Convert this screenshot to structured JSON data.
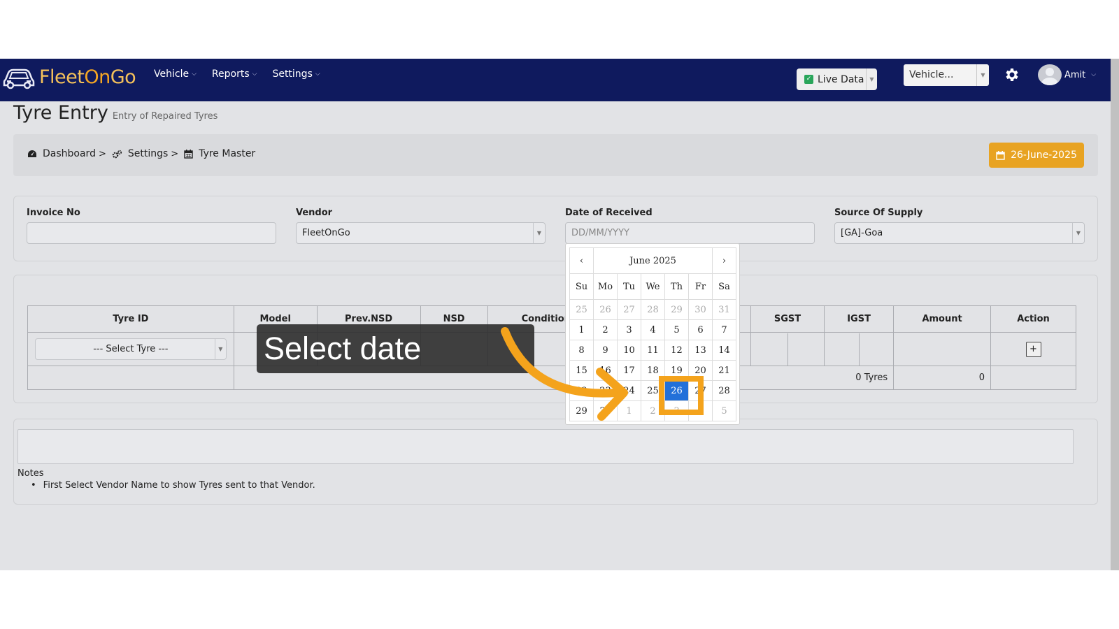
{
  "navbar": {
    "brand_parts": [
      "Fleet",
      "On",
      "Go"
    ],
    "menu": [
      "Vehicle",
      "Reports",
      "Settings"
    ],
    "live_data_label": "Live Data",
    "vehicle_select": "Vehicle...",
    "user_name": "Amit"
  },
  "page": {
    "title": "Tyre Entry",
    "subtitle": "Entry of Repaired Tyres"
  },
  "breadcrumb": {
    "items": [
      "Dashboard",
      "Settings",
      "Tyre Master"
    ],
    "separator": ">",
    "date_button": "26-June-2025"
  },
  "form": {
    "invoice_label": "Invoice No",
    "invoice_value": "",
    "vendor_label": "Vendor",
    "vendor_value": "FleetOnGo",
    "date_label": "Date of Received",
    "date_placeholder": "DD/MM/YYYY",
    "source_label": "Source Of Supply",
    "source_value": "[GA]-Goa"
  },
  "table": {
    "headers": [
      "Tyre ID",
      "Model",
      "Prev.NSD",
      "NSD",
      "Condition",
      "SGST",
      "IGST",
      "Amount",
      "Action"
    ],
    "select_tyre": "--- Select Tyre ---",
    "add_button": "+",
    "total_tyres": "0 Tyres",
    "total_amount": "0"
  },
  "notes": {
    "title": "Notes",
    "items": [
      "First Select Vendor Name to show Tyres sent to that Vendor."
    ]
  },
  "datepicker": {
    "month_label": "June 2025",
    "prev": "‹",
    "next": "›",
    "weekdays": [
      "Su",
      "Mo",
      "Tu",
      "We",
      "Th",
      "Fr",
      "Sa"
    ],
    "weeks": [
      [
        "25",
        "26",
        "27",
        "28",
        "29",
        "30",
        "31"
      ],
      [
        "1",
        "2",
        "3",
        "4",
        "5",
        "6",
        "7"
      ],
      [
        "8",
        "9",
        "10",
        "11",
        "12",
        "13",
        "14"
      ],
      [
        "15",
        "16",
        "17",
        "18",
        "19",
        "20",
        "21"
      ],
      [
        "22",
        "23",
        "24",
        "25",
        "26",
        "27",
        "28"
      ],
      [
        "29",
        "30",
        "1",
        "2",
        "3",
        "4",
        "5"
      ]
    ],
    "selected": "26"
  },
  "overlay": {
    "tooltip": "Select date"
  },
  "colors": {
    "navbar": "#0f1a5e",
    "accent_orange": "#e8a322",
    "selected_blue": "#2270d9",
    "highlight": "#f4a31c"
  }
}
